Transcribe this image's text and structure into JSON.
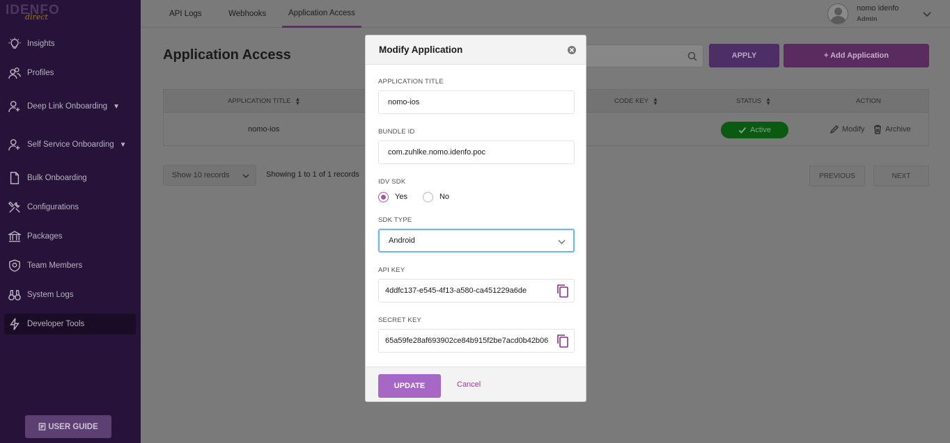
{
  "sidebar": {
    "logo_text": "IDENFO",
    "logo_sub": "direct",
    "items": [
      {
        "label": "Insights",
        "icon": "lightbulb-icon"
      },
      {
        "label": "Profiles",
        "icon": "users-icon"
      },
      {
        "label": "Deep Link Onboarding",
        "icon": "user-plus-icon",
        "caret": "▼"
      },
      {
        "label": "Self Service Onboarding",
        "icon": "user-plus-icon",
        "caret": "▼"
      },
      {
        "label": "Bulk Onboarding",
        "icon": "file-icon"
      },
      {
        "label": "Configurations",
        "icon": "tools-icon"
      },
      {
        "label": "Packages",
        "icon": "bank-icon"
      },
      {
        "label": "Team Members",
        "icon": "shield-icon"
      },
      {
        "label": "System Logs",
        "icon": "binoculars-icon"
      },
      {
        "label": "Developer Tools",
        "icon": "bolt-icon"
      }
    ],
    "guide_label": "USER GUIDE"
  },
  "topbar": {
    "tabs": [
      "API Logs",
      "Webhooks",
      "Application Access"
    ],
    "active_tab": "Application Access",
    "user_name": "nomo idenfo",
    "user_role": "Admin"
  },
  "main": {
    "title": "Application Access",
    "apply_label": "APPLY",
    "add_label": "+ Add Application",
    "table": {
      "headers": [
        "APPLICATION TITLE",
        "CODE KEY",
        "STATUS",
        "ACTION"
      ],
      "rows": [
        {
          "title": "nomo-ios",
          "status": "Active",
          "edit": "Modify",
          "archive": "Archive"
        }
      ]
    },
    "records_select": "Show 10 records",
    "showing": "Showing 1 to 1 of 1 records",
    "prev_label": "PREVIOUS",
    "next_label": "NEXT"
  },
  "modal": {
    "title": "Modify Application",
    "app_title_label": "APPLICATION TITLE",
    "app_title_value": "nomo-ios",
    "bundle_label": "BUNDLE ID",
    "bundle_value": "com.zuhlke.nomo.idenfo.poc",
    "idv_label": "IDV SDK",
    "idv_yes": "Yes",
    "idv_no": "No",
    "idv_selected": "Yes",
    "sdk_type_label": "SDK TYPE",
    "sdk_type_value": "Android",
    "api_key_label": "API KEY",
    "api_key_value": "4ddfc137-e545-4f13-a580-ca451229a6de",
    "secret_key_label": "SECRET KEY",
    "secret_key_value": "65a59fe28af693902ce84b915f2be7acd0b42b06",
    "update_label": "UPDATE",
    "cancel_label": "Cancel"
  },
  "colors": {
    "sidebar_bg": "#271239",
    "overlay": "#7a7a7a",
    "accent_purple": "#a767c4",
    "status_active": "#0a5a12"
  }
}
